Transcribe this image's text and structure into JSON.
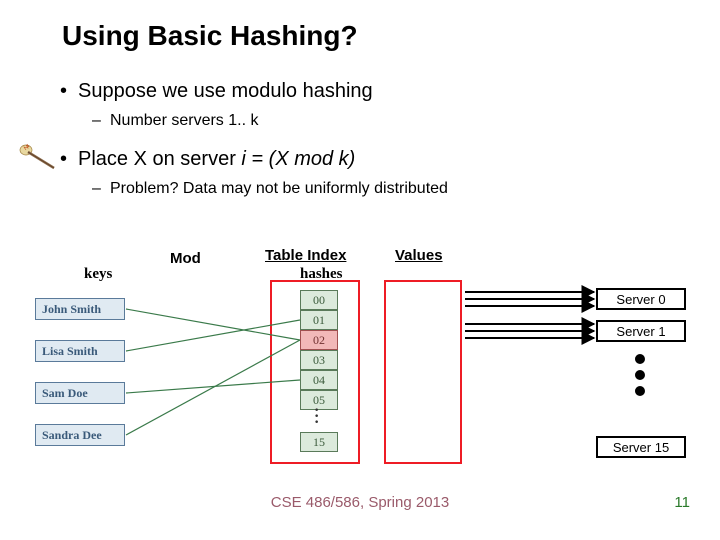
{
  "title": "Using Basic Hashing?",
  "bullets": {
    "b1": "Suppose we use modulo hashing",
    "b1s1": "Number servers 1.. k",
    "b2_pre": "Place X on server ",
    "b2_em": "i = (X mod k)",
    "b2s1": "Problem?  Data may not be uniformly distributed"
  },
  "labels": {
    "keys": "keys",
    "mod": "Mod",
    "table_index": "Table Index",
    "hashes": "hashes",
    "values": "Values"
  },
  "keys": [
    "John Smith",
    "Lisa Smith",
    "Sam Doe",
    "Sandra Dee"
  ],
  "hashes": {
    "cells": [
      "00",
      "01",
      "02",
      "03",
      "04",
      "05"
    ],
    "highlight_index": 2,
    "last": "15"
  },
  "servers": {
    "s0": "Server 0",
    "s1": "Server 1",
    "s15": "Server 15"
  },
  "footer": {
    "course": "CSE 486/586, Spring 2013",
    "page": "11"
  }
}
